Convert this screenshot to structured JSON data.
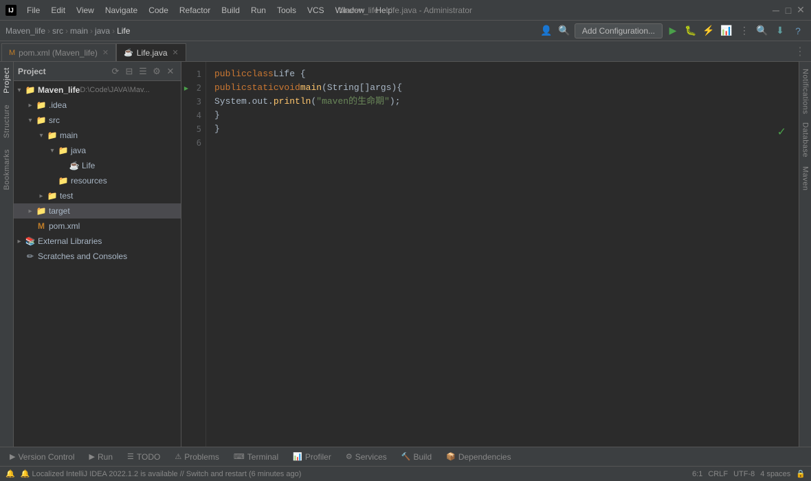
{
  "titleBar": {
    "logo": "IJ",
    "title": "Maven_life - Life.java - Administrator",
    "menu": [
      "File",
      "Edit",
      "View",
      "Navigate",
      "Code",
      "Refactor",
      "Build",
      "Run",
      "Tools",
      "VCS",
      "Window",
      "Help"
    ]
  },
  "toolbar": {
    "breadcrumbs": [
      "Maven_life",
      "src",
      "main",
      "java",
      "Life"
    ],
    "addConfigLabel": "Add Configuration...",
    "icons": [
      "run",
      "debug",
      "coverage",
      "profile",
      "more"
    ]
  },
  "tabs": {
    "items": [
      {
        "label": "pom.xml (Maven_life)",
        "icon": "M",
        "active": false
      },
      {
        "label": "Life.java",
        "icon": "☕",
        "active": true
      }
    ]
  },
  "project": {
    "title": "Project",
    "tree": [
      {
        "indent": 0,
        "hasArrow": true,
        "arrowOpen": true,
        "icon": "📁",
        "iconColor": "#6897bb",
        "label": "Maven_life",
        "extra": "D:\\Code\\JAVA\\Mav...",
        "bold": true
      },
      {
        "indent": 1,
        "hasArrow": true,
        "arrowOpen": false,
        "icon": "📁",
        "iconColor": "#6897bb",
        "label": ".idea",
        "bold": false
      },
      {
        "indent": 1,
        "hasArrow": true,
        "arrowOpen": true,
        "icon": "📁",
        "iconColor": "#6897bb",
        "label": "src",
        "bold": false
      },
      {
        "indent": 2,
        "hasArrow": true,
        "arrowOpen": true,
        "icon": "📁",
        "iconColor": "#6897bb",
        "label": "main",
        "bold": false
      },
      {
        "indent": 3,
        "hasArrow": true,
        "arrowOpen": true,
        "icon": "📁",
        "iconColor": "#6897bb",
        "label": "java",
        "bold": false
      },
      {
        "indent": 4,
        "hasArrow": false,
        "icon": "☕",
        "iconColor": "#c07d28",
        "label": "Life",
        "bold": false,
        "selected": false
      },
      {
        "indent": 3,
        "hasArrow": false,
        "icon": "📁",
        "iconColor": "#6897bb",
        "label": "resources",
        "bold": false
      },
      {
        "indent": 2,
        "hasArrow": true,
        "arrowOpen": false,
        "icon": "📁",
        "iconColor": "#6897bb",
        "label": "test",
        "bold": false
      },
      {
        "indent": 1,
        "hasArrow": true,
        "arrowOpen": false,
        "icon": "📁",
        "iconColor": "#e69e28",
        "label": "target",
        "bold": false,
        "highlighted": true
      },
      {
        "indent": 1,
        "hasArrow": false,
        "icon": "M",
        "iconColor": "#c07d28",
        "label": "pom.xml",
        "bold": false
      },
      {
        "indent": 0,
        "hasArrow": true,
        "arrowOpen": false,
        "icon": "📚",
        "iconColor": "#6897bb",
        "label": "External Libraries",
        "bold": false
      },
      {
        "indent": 0,
        "hasArrow": false,
        "icon": "✏",
        "iconColor": "#a9b7c6",
        "label": "Scratches and Consoles",
        "bold": false
      }
    ]
  },
  "code": {
    "lines": [
      {
        "num": 1,
        "hasRun": false,
        "content": "public class Life {"
      },
      {
        "num": 2,
        "hasRun": true,
        "content": "    public static void main(String[] args) {"
      },
      {
        "num": 3,
        "hasRun": false,
        "content": "        System.out.println(\"maven的生命期\");"
      },
      {
        "num": 4,
        "hasRun": false,
        "content": "    }"
      },
      {
        "num": 5,
        "hasRun": false,
        "content": "}"
      },
      {
        "num": 6,
        "hasRun": false,
        "content": ""
      }
    ]
  },
  "bottomBar": {
    "tabs": [
      {
        "icon": "▶",
        "label": "Version Control",
        "active": false
      },
      {
        "icon": "▶",
        "label": "Run",
        "active": false
      },
      {
        "icon": "☰",
        "label": "TODO",
        "active": false
      },
      {
        "icon": "⚠",
        "label": "Problems",
        "active": false
      },
      {
        "icon": "⌨",
        "label": "Terminal",
        "active": false
      },
      {
        "icon": "📊",
        "label": "Profiler",
        "active": false
      },
      {
        "icon": "⚙",
        "label": "Services",
        "active": false
      },
      {
        "icon": "🔨",
        "label": "Build",
        "active": false
      },
      {
        "icon": "📦",
        "label": "Dependencies",
        "active": false
      }
    ]
  },
  "statusBar": {
    "warning": "🔔 Localized IntelliJ IDEA 2022.1.2 is available // Switch and restart (6 minutes ago)",
    "position": "6:1",
    "lineEnding": "CRLF",
    "encoding": "UTF-8",
    "indent": "4 spaces",
    "lockIcon": "🔒"
  },
  "rightPanels": [
    "Notifications",
    "Database",
    "Maven"
  ],
  "leftPanels": [
    "Structure",
    "Bookmarks"
  ]
}
